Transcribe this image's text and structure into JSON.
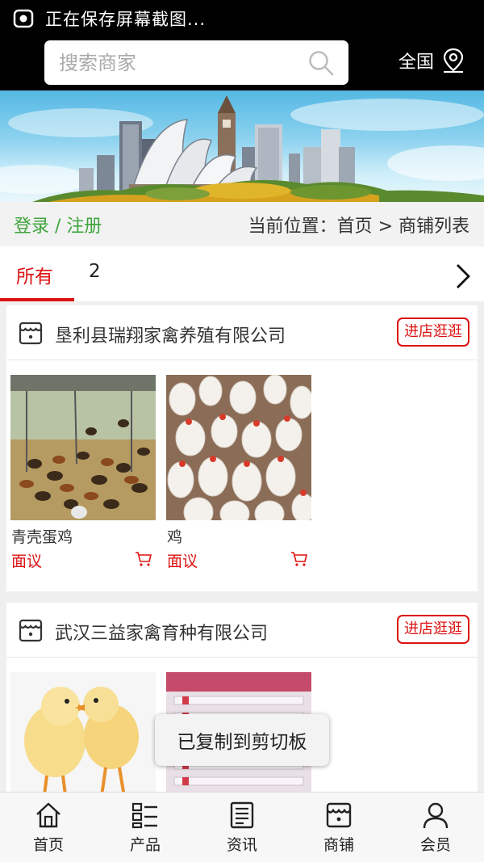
{
  "status_bar": {
    "text": "正在保存屏幕截图..."
  },
  "header": {
    "search_placeholder": "搜索商家",
    "region_label": "全国"
  },
  "breadcrumb": {
    "login": "登录",
    "separator": " / ",
    "register": "注册",
    "position_text": "当前位置：首页 > 商铺列表"
  },
  "tabs": [
    {
      "label": "所有",
      "active": true
    },
    {
      "label": "2",
      "active": false
    }
  ],
  "shops": [
    {
      "name": "垦利县瑞翔家禽养殖有限公司",
      "visit_label": "进店逛逛",
      "products": [
        {
          "name": "青壳蛋鸡",
          "price": "面议"
        },
        {
          "name": "鸡",
          "price": "面议"
        }
      ]
    },
    {
      "name": "武汉三益家禽育种有限公司",
      "visit_label": "进店逛逛",
      "products": [
        {
          "name": "",
          "price": ""
        },
        {
          "name": "",
          "price": ""
        }
      ]
    }
  ],
  "toast": "已复制到剪切板",
  "bottom_nav": [
    {
      "label": "首页",
      "icon": "home-icon"
    },
    {
      "label": "产品",
      "icon": "list-icon"
    },
    {
      "label": "资讯",
      "icon": "news-icon"
    },
    {
      "label": "商铺",
      "icon": "shop-icon"
    },
    {
      "label": "会员",
      "icon": "user-icon"
    }
  ],
  "colors": {
    "accent": "#dd1111",
    "login_green": "#3fa43b",
    "header_bg": "#000000"
  }
}
